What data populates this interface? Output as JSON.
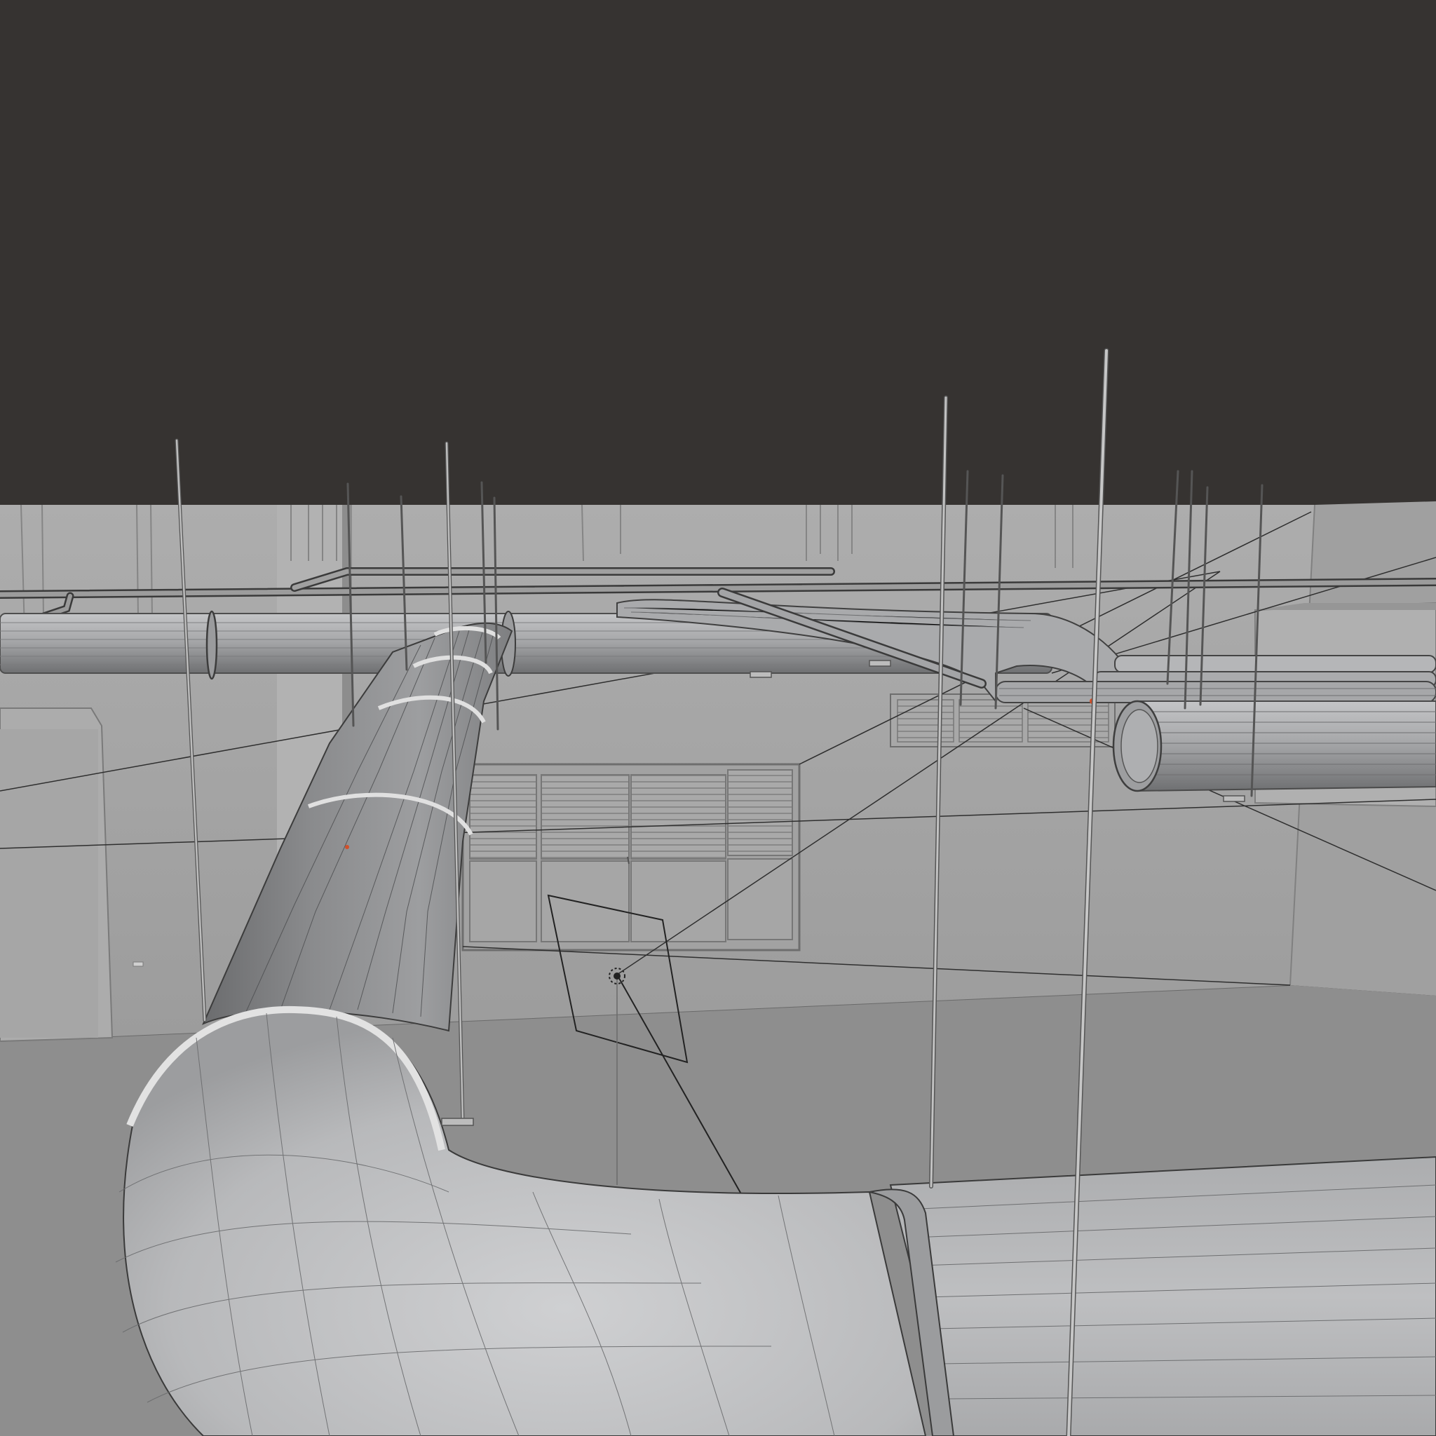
{
  "app": {
    "name": "",
    "view": "3D viewport"
  },
  "viewport": {
    "background_color": "#363331",
    "shading": "solid",
    "overlay": "wireframe",
    "wall_color": "#a3a3a3",
    "floor_color": "#8e8e8e",
    "duct_color": "#b4b5b7",
    "selection_color": "#d2502a"
  },
  "scene": {
    "objects": [
      "room-walls",
      "floor",
      "main-duct-horizontal",
      "duct-elbow-foreground",
      "duct-vertical-run",
      "duct-foreground-run",
      "right-duct-branch",
      "ceiling-pipe",
      "window-louvered",
      "vent-grille",
      "door-frame",
      "light-camera-gizmo",
      "suspension-rods"
    ]
  }
}
